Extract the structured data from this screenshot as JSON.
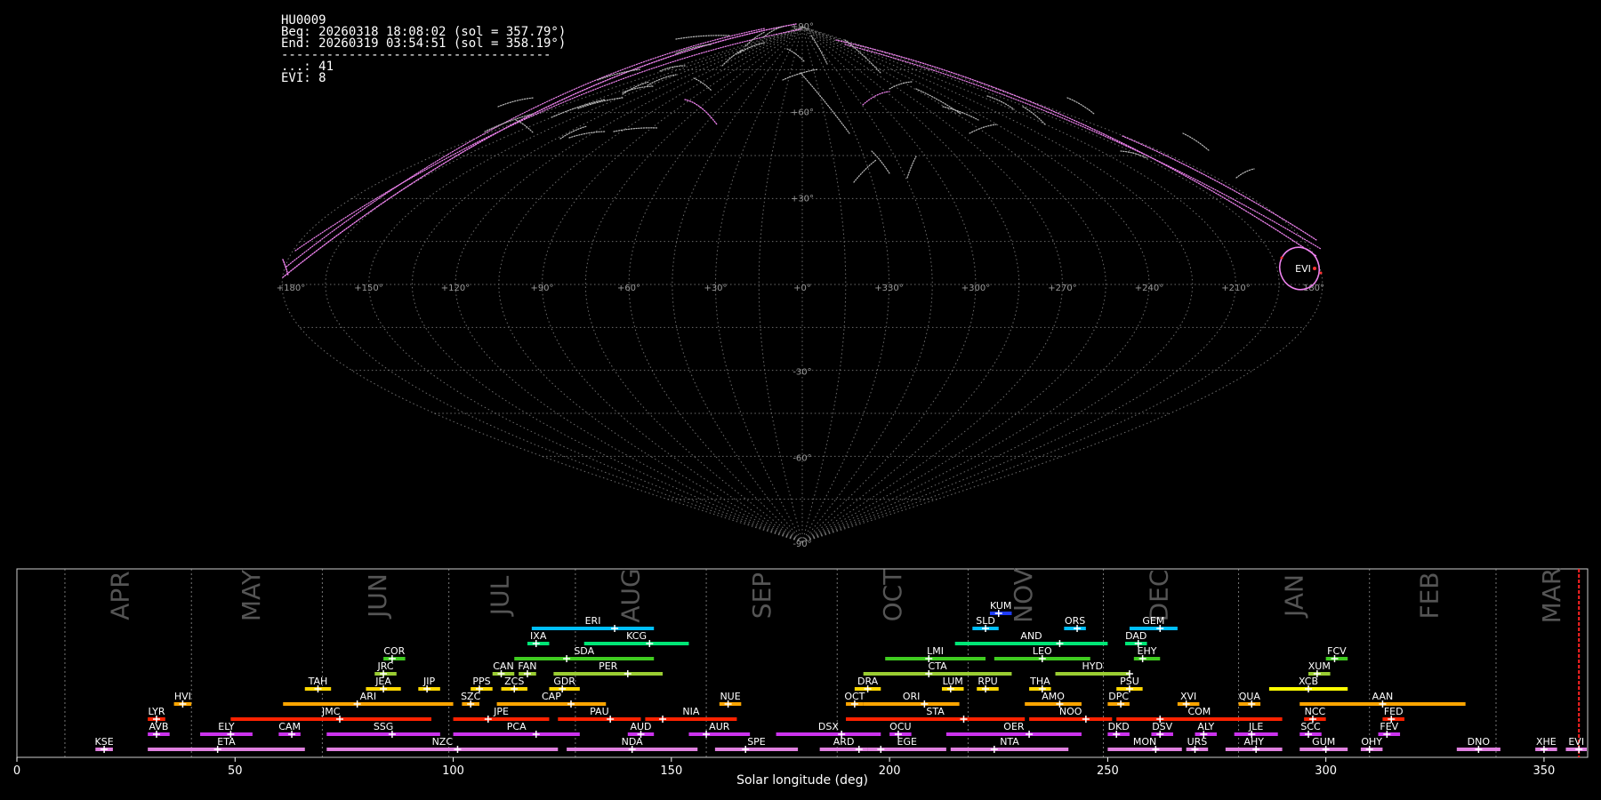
{
  "info": {
    "station": "HU0009",
    "beg": "Beg: 20260318 18:08:02 (sol = 357.79°)",
    "end": "End: 20260319 03:54:51 (sol = 358.19°)",
    "separator": "------------------------------------",
    "sporadic_count": "...: 41",
    "shower_count": "EVI: 8"
  },
  "sky": {
    "lon_labels": [
      "+180°",
      "+150°",
      "+120°",
      "+90°",
      "+60°",
      "+30°",
      "+0°",
      "+330°",
      "+300°",
      "+270°",
      "+240°",
      "+210°",
      "180°"
    ],
    "lat_labels": [
      "+90°",
      "+60°",
      "+30°",
      "+0°",
      "-30°",
      "-60°",
      "-90°"
    ],
    "shower_label": "EVI",
    "colors": {
      "grid": "#888888",
      "sporadic": "#bbbbbb",
      "shower": "#ee82ee",
      "radiant": "#ff3333"
    }
  },
  "chart_data": {
    "type": "timeline",
    "xlabel": "Solar longitude (deg)",
    "xlim": [
      0,
      360
    ],
    "xticks": [
      0,
      50,
      100,
      150,
      200,
      250,
      300,
      350
    ],
    "current_sol": 358.0,
    "months": [
      {
        "name": "APR",
        "boundary": 11,
        "center": 24
      },
      {
        "name": "MAY",
        "boundary": 40,
        "center": 54
      },
      {
        "name": "JUN",
        "boundary": 70,
        "center": 83
      },
      {
        "name": "JUL",
        "boundary": 99,
        "center": 111
      },
      {
        "name": "AUG",
        "boundary": 128,
        "center": 141
      },
      {
        "name": "SEP",
        "boundary": 158,
        "center": 171
      },
      {
        "name": "OCT",
        "boundary": 188,
        "center": 201
      },
      {
        "name": "NOV",
        "boundary": 218,
        "center": 231
      },
      {
        "name": "DEC",
        "boundary": 249,
        "center": 262
      },
      {
        "name": "JAN",
        "boundary": 280,
        "center": 293
      },
      {
        "name": "FEB",
        "boundary": 310,
        "center": 324
      },
      {
        "name": "MAR",
        "boundary": 339,
        "center": 352
      }
    ],
    "showers": [
      {
        "code": "KUM",
        "start": 223,
        "end": 228,
        "peak": 225,
        "row": 10,
        "color": "#1e3cff"
      },
      {
        "code": "ERI",
        "start": 118,
        "end": 146,
        "peak": 137,
        "row": 9,
        "color": "#00bfff"
      },
      {
        "code": "SLD",
        "start": 219,
        "end": 225,
        "peak": 222,
        "row": 9,
        "color": "#00bfff"
      },
      {
        "code": "ORS",
        "start": 240,
        "end": 245,
        "peak": 243,
        "row": 9,
        "color": "#00bfff"
      },
      {
        "code": "GEM",
        "start": 255,
        "end": 266,
        "peak": 262,
        "row": 9,
        "color": "#00bfff"
      },
      {
        "code": "IXA",
        "start": 117,
        "end": 122,
        "peak": 119,
        "row": 8,
        "color": "#00e676"
      },
      {
        "code": "KCG",
        "start": 130,
        "end": 154,
        "peak": 145,
        "row": 8,
        "color": "#00e676"
      },
      {
        "code": "AND",
        "start": 215,
        "end": 250,
        "peak": 239,
        "row": 8,
        "color": "#00e676"
      },
      {
        "code": "DAD",
        "start": 254,
        "end": 259,
        "peak": 257,
        "row": 8,
        "color": "#00e676"
      },
      {
        "code": "COR",
        "start": 84,
        "end": 89,
        "peak": 86,
        "row": 7,
        "color": "#40cc20"
      },
      {
        "code": "SDA",
        "start": 114,
        "end": 146,
        "peak": 126,
        "row": 7,
        "color": "#40cc20"
      },
      {
        "code": "LMI",
        "start": 199,
        "end": 222,
        "peak": 209,
        "row": 7,
        "color": "#40cc20"
      },
      {
        "code": "LEO",
        "start": 224,
        "end": 246,
        "peak": 235,
        "row": 7,
        "color": "#40cc20"
      },
      {
        "code": "EHY",
        "start": 256,
        "end": 262,
        "peak": 258,
        "row": 7,
        "color": "#40cc20"
      },
      {
        "code": "FCV",
        "start": 300,
        "end": 305,
        "peak": 302,
        "row": 7,
        "color": "#40cc20"
      },
      {
        "code": "JRC",
        "start": 82,
        "end": 87,
        "peak": 84,
        "row": 6,
        "color": "#9acd32"
      },
      {
        "code": "CAN",
        "start": 109,
        "end": 114,
        "peak": 111,
        "row": 6,
        "color": "#9acd32"
      },
      {
        "code": "FAN",
        "start": 115,
        "end": 119,
        "peak": 117,
        "row": 6,
        "color": "#9acd32"
      },
      {
        "code": "PER",
        "start": 123,
        "end": 148,
        "peak": 140,
        "row": 6,
        "color": "#9acd32"
      },
      {
        "code": "CTA",
        "start": 194,
        "end": 228,
        "peak": 209,
        "row": 6,
        "color": "#9acd32"
      },
      {
        "code": "HYD",
        "start": 238,
        "end": 255,
        "peak": 255,
        "row": 6,
        "color": "#9acd32"
      },
      {
        "code": "XUM",
        "start": 296,
        "end": 301,
        "peak": 298,
        "row": 6,
        "color": "#9acd32"
      },
      {
        "code": "TAH",
        "start": 66,
        "end": 72,
        "peak": 69,
        "row": 5,
        "color": "#ffd700"
      },
      {
        "code": "JEA",
        "start": 80,
        "end": 88,
        "peak": 84,
        "row": 5,
        "color": "#ffd700"
      },
      {
        "code": "JIP",
        "start": 92,
        "end": 97,
        "peak": 94,
        "row": 5,
        "color": "#ffd700"
      },
      {
        "code": "PPS",
        "start": 104,
        "end": 109,
        "peak": 106,
        "row": 5,
        "color": "#ffd700"
      },
      {
        "code": "ZCS",
        "start": 111,
        "end": 117,
        "peak": 114,
        "row": 5,
        "color": "#ffd700"
      },
      {
        "code": "GDR",
        "start": 122,
        "end": 129,
        "peak": 125,
        "row": 5,
        "color": "#ffd700"
      },
      {
        "code": "DRA",
        "start": 192,
        "end": 198,
        "peak": 195,
        "row": 5,
        "color": "#ffd700"
      },
      {
        "code": "LUM",
        "start": 212,
        "end": 217,
        "peak": 214,
        "row": 5,
        "color": "#ffd700"
      },
      {
        "code": "RPU",
        "start": 220,
        "end": 225,
        "peak": 222,
        "row": 5,
        "color": "#ffd700"
      },
      {
        "code": "THA",
        "start": 232,
        "end": 237,
        "peak": 235,
        "row": 5,
        "color": "#ffd700"
      },
      {
        "code": "PSU",
        "start": 252,
        "end": 258,
        "peak": 255,
        "row": 5,
        "color": "#ffd700"
      },
      {
        "code": "XCB",
        "start": 287,
        "end": 305,
        "peak": 296,
        "row": 5,
        "color": "#ffff00"
      },
      {
        "code": "HVI",
        "start": 36,
        "end": 40,
        "peak": 38,
        "row": 4,
        "color": "#ffa500"
      },
      {
        "code": "ARI",
        "start": 61,
        "end": 100,
        "peak": 78,
        "row": 4,
        "color": "#ffa500"
      },
      {
        "code": "SZC",
        "start": 102,
        "end": 106,
        "peak": 104,
        "row": 4,
        "color": "#ffa500"
      },
      {
        "code": "CAP",
        "start": 110,
        "end": 135,
        "peak": 127,
        "row": 4,
        "color": "#ffa500"
      },
      {
        "code": "NUE",
        "start": 161,
        "end": 166,
        "peak": 163,
        "row": 4,
        "color": "#ffa500"
      },
      {
        "code": "OCT",
        "start": 190,
        "end": 194,
        "peak": 192,
        "row": 4,
        "color": "#ffa500"
      },
      {
        "code": "ORI",
        "start": 194,
        "end": 216,
        "peak": 208,
        "row": 4,
        "color": "#ffa500"
      },
      {
        "code": "AMO",
        "start": 231,
        "end": 244,
        "peak": 239,
        "row": 4,
        "color": "#ffa500"
      },
      {
        "code": "DPC",
        "start": 250,
        "end": 255,
        "peak": 253,
        "row": 4,
        "color": "#ffa500"
      },
      {
        "code": "XVI",
        "start": 266,
        "end": 271,
        "peak": 268,
        "row": 4,
        "color": "#ffa500"
      },
      {
        "code": "QUA",
        "start": 280,
        "end": 285,
        "peak": 283,
        "row": 4,
        "color": "#ffa500"
      },
      {
        "code": "AAN",
        "start": 294,
        "end": 332,
        "peak": 313,
        "row": 4,
        "color": "#ffa500"
      },
      {
        "code": "LYR",
        "start": 30,
        "end": 34,
        "peak": 32,
        "row": 3,
        "color": "#ff2200"
      },
      {
        "code": "JMC",
        "start": 49,
        "end": 95,
        "peak": 74,
        "row": 3,
        "color": "#ff2200"
      },
      {
        "code": "JPE",
        "start": 100,
        "end": 122,
        "peak": 108,
        "row": 3,
        "color": "#ff2200"
      },
      {
        "code": "PAU",
        "start": 124,
        "end": 143,
        "peak": 136,
        "row": 3,
        "color": "#ff2200"
      },
      {
        "code": "NIA",
        "start": 144,
        "end": 165,
        "peak": 148,
        "row": 3,
        "color": "#ff2200"
      },
      {
        "code": "STA",
        "start": 190,
        "end": 231,
        "peak": 217,
        "row": 3,
        "color": "#ff2200"
      },
      {
        "code": "NOO",
        "start": 232,
        "end": 251,
        "peak": 245,
        "row": 3,
        "color": "#ff2200"
      },
      {
        "code": "COM",
        "start": 252,
        "end": 290,
        "peak": 262,
        "row": 3,
        "color": "#ff2200"
      },
      {
        "code": "NCC",
        "start": 295,
        "end": 300,
        "peak": 297,
        "row": 3,
        "color": "#ff2200"
      },
      {
        "code": "FED",
        "start": 313,
        "end": 318,
        "peak": 315,
        "row": 3,
        "color": "#ff2200"
      },
      {
        "code": "AVB",
        "start": 30,
        "end": 35,
        "peak": 32,
        "row": 2,
        "color": "#cc33ee"
      },
      {
        "code": "ELY",
        "start": 42,
        "end": 54,
        "peak": 49,
        "row": 2,
        "color": "#cc33ee"
      },
      {
        "code": "CAM",
        "start": 60,
        "end": 65,
        "peak": 63,
        "row": 2,
        "color": "#cc33ee"
      },
      {
        "code": "SSG",
        "start": 71,
        "end": 97,
        "peak": 86,
        "row": 2,
        "color": "#cc33ee"
      },
      {
        "code": "PCA",
        "start": 100,
        "end": 129,
        "peak": 119,
        "row": 2,
        "color": "#cc33ee"
      },
      {
        "code": "AUD",
        "start": 140,
        "end": 146,
        "peak": 143,
        "row": 2,
        "color": "#cc33ee"
      },
      {
        "code": "AUR",
        "start": 154,
        "end": 168,
        "peak": 158,
        "row": 2,
        "color": "#cc33ee"
      },
      {
        "code": "DSX",
        "start": 174,
        "end": 198,
        "peak": 189,
        "row": 2,
        "color": "#cc33ee"
      },
      {
        "code": "OCU",
        "start": 200,
        "end": 205,
        "peak": 202,
        "row": 2,
        "color": "#cc33ee"
      },
      {
        "code": "OER",
        "start": 213,
        "end": 244,
        "peak": 232,
        "row": 2,
        "color": "#cc33ee"
      },
      {
        "code": "DKD",
        "start": 250,
        "end": 255,
        "peak": 252,
        "row": 2,
        "color": "#cc33ee"
      },
      {
        "code": "DSV",
        "start": 260,
        "end": 265,
        "peak": 262,
        "row": 2,
        "color": "#cc33ee"
      },
      {
        "code": "ALY",
        "start": 270,
        "end": 275,
        "peak": 272,
        "row": 2,
        "color": "#cc33ee"
      },
      {
        "code": "JLE",
        "start": 279,
        "end": 289,
        "peak": 283,
        "row": 2,
        "color": "#cc33ee"
      },
      {
        "code": "SCC",
        "start": 294,
        "end": 299,
        "peak": 296,
        "row": 2,
        "color": "#cc33ee"
      },
      {
        "code": "FEV",
        "start": 312,
        "end": 317,
        "peak": 314,
        "row": 2,
        "color": "#cc33ee"
      },
      {
        "code": "KSE",
        "start": 18,
        "end": 22,
        "peak": 20,
        "row": 1,
        "color": "#e080e0"
      },
      {
        "code": "ETA",
        "start": 30,
        "end": 66,
        "peak": 46,
        "row": 1,
        "color": "#e080e0"
      },
      {
        "code": "NZC",
        "start": 71,
        "end": 124,
        "peak": 101,
        "row": 1,
        "color": "#e080e0"
      },
      {
        "code": "NDA",
        "start": 126,
        "end": 156,
        "peak": 141,
        "row": 1,
        "color": "#e080e0"
      },
      {
        "code": "SPE",
        "start": 160,
        "end": 179,
        "peak": 167,
        "row": 1,
        "color": "#e080e0"
      },
      {
        "code": "ARD",
        "start": 184,
        "end": 195,
        "peak": 193,
        "row": 1,
        "color": "#e080e0"
      },
      {
        "code": "EGE",
        "start": 195,
        "end": 213,
        "peak": 198,
        "row": 1,
        "color": "#e080e0"
      },
      {
        "code": "NTA",
        "start": 214,
        "end": 241,
        "peak": 224,
        "row": 1,
        "color": "#e080e0"
      },
      {
        "code": "MON",
        "start": 250,
        "end": 267,
        "peak": 261,
        "row": 1,
        "color": "#e080e0"
      },
      {
        "code": "URS",
        "start": 268,
        "end": 273,
        "peak": 270,
        "row": 1,
        "color": "#e080e0"
      },
      {
        "code": "AHY",
        "start": 277,
        "end": 290,
        "peak": 284,
        "row": 1,
        "color": "#e080e0"
      },
      {
        "code": "GUM",
        "start": 294,
        "end": 305,
        "peak": 300,
        "row": 1,
        "color": "#e080e0"
      },
      {
        "code": "OHY",
        "start": 308,
        "end": 313,
        "peak": 310,
        "row": 1,
        "color": "#e080e0"
      },
      {
        "code": "DNO",
        "start": 330,
        "end": 340,
        "peak": 335,
        "row": 1,
        "color": "#e080e0"
      },
      {
        "code": "XHE",
        "start": 348,
        "end": 353,
        "peak": 350,
        "row": 1,
        "color": "#e080e0"
      },
      {
        "code": "EVI",
        "start": 355,
        "end": 361,
        "peak": 358,
        "row": 1,
        "color": "#e080e0"
      }
    ]
  }
}
